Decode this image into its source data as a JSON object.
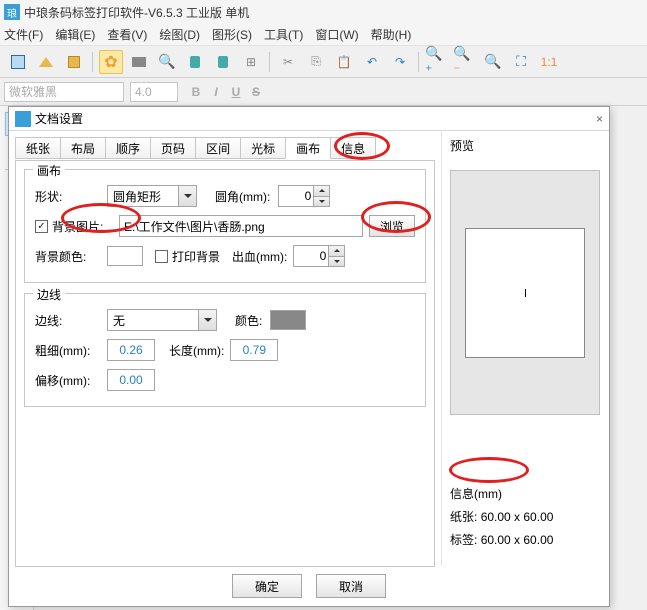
{
  "app": {
    "title": "中琅条码标签打印软件-V6.5.3 工业版 单机"
  },
  "menu": {
    "file": "文件(F)",
    "edit": "编辑(E)",
    "view": "查看(V)",
    "draw": "绘图(D)",
    "shape": "图形(S)",
    "tool": "工具(T)",
    "window": "窗口(W)",
    "help": "帮助(H)"
  },
  "format": {
    "font": "微软雅黑",
    "size": "4.0",
    "B": "B",
    "I": "I",
    "U": "U",
    "S": "S"
  },
  "dialog": {
    "title": "文档设置",
    "tabs": [
      "纸张",
      "布局",
      "顺序",
      "页码",
      "区间",
      "光标",
      "画布",
      "信息"
    ],
    "active_tab": "画布",
    "canvas": {
      "group": "画布",
      "shape_label": "形状:",
      "shape_value": "圆角矩形",
      "radius_label": "圆角(mm):",
      "radius_value": "0",
      "bgimg_label": "背景图片:",
      "bgimg_checked": true,
      "bgimg_value": "E:\\工作文件\\图片\\香肠.png",
      "browse": "浏览",
      "bgcolor_label": "背景颜色:",
      "print_bg_label": "打印背景",
      "print_bg_checked": false,
      "bleed_label": "出血(mm):",
      "bleed_value": "0"
    },
    "border": {
      "group": "边线",
      "edge_label": "边线:",
      "edge_value": "无",
      "color_label": "颜色:",
      "thick_label": "粗细(mm):",
      "thick_value": "0.26",
      "len_label": "长度(mm):",
      "len_value": "0.79",
      "offset_label": "偏移(mm):",
      "offset_value": "0.00"
    },
    "preview": {
      "title": "预览"
    },
    "info": {
      "title": "信息(mm)",
      "paper_label": "纸张:",
      "paper_value": "60.00 x 60.00",
      "label_label": "标签:",
      "label_value": "60.00 x 60.00"
    },
    "ok": "确定",
    "cancel": "取消",
    "close": "×"
  }
}
